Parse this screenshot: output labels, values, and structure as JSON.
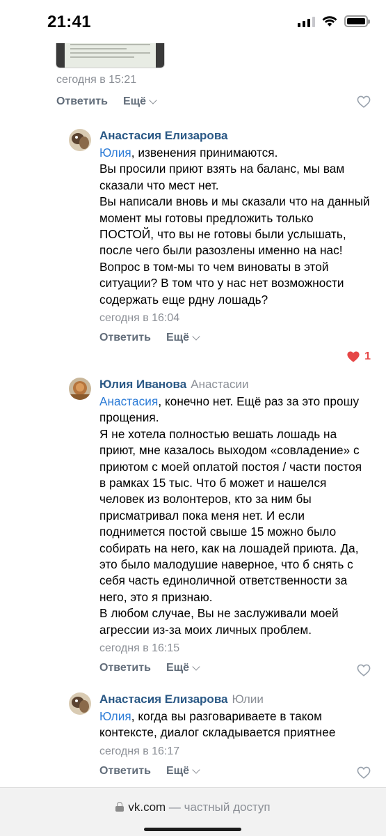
{
  "status_bar": {
    "time": "21:41"
  },
  "prev_comment": {
    "time": "сегодня в 15:21",
    "reply_label": "Ответить",
    "more_label": "Ещё"
  },
  "comments": [
    {
      "author": "Анастасия Елизарова",
      "reply_to": "",
      "mention": "Юлия",
      "text": ", извенения принимаются.\nВы просили приют взять на баланс, мы вам сказали что мест нет.\nВы написали вновь и мы сказали что на данный момент мы готовы предложить только ПОСТОЙ, что вы не готовы были услышать, после чего были разозлены именно на нас!\nВопрос в том-мы то чем виноваты в этой ситуации? В том что у нас нет возможности содержать еще рдну лошадь?",
      "time": "сегодня в 16:04",
      "reply_label": "Ответить",
      "more_label": "Ещё",
      "likes": "1",
      "liked": true
    },
    {
      "author": "Юлия Иванова",
      "reply_to": "Анастасии",
      "mention": "Анастасия",
      "text": ", конечно нет. Ещё раз за это прошу прощения.\nЯ не хотела полностью вешать лошадь на приют, мне казалось выходом «совладение» с приютом с моей оплатой постоя / части постоя в рамках 15 тыс. Что б может и нашелся человек из волонтеров, кто за ним бы присматривал пока меня нет. И если поднимется постой свыше 15 можно было собирать на него, как на лошадей приюта. Да, это было малодушие наверное, что б снять с себя часть единоличной ответственности за него, это я признаю.\nВ любом случае, Вы не заслуживали моей агрессии из-за моих личных проблем.",
      "time": "сегодня в 16:15",
      "reply_label": "Ответить",
      "more_label": "Ещё",
      "likes": "",
      "liked": false
    },
    {
      "author": "Анастасия Елизарова",
      "reply_to": "Юлии",
      "mention": "Юлия",
      "text": ", когда вы разговариваете в таком контексте, диалог складывается приятнее",
      "time": "сегодня в 16:17",
      "reply_label": "Ответить",
      "more_label": "Ещё",
      "likes": "",
      "liked": false
    }
  ],
  "url_bar": {
    "domain": "vk.com",
    "note": "— частный доступ"
  },
  "colors": {
    "link": "#2a5885",
    "mention": "#2a7ad6",
    "like_active": "#e64646",
    "muted": "#8b8f96"
  }
}
